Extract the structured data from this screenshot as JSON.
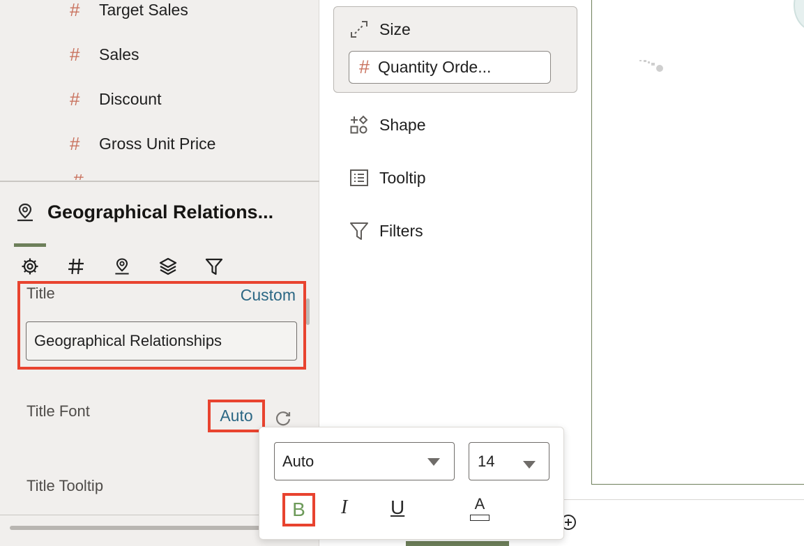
{
  "data_elements": {
    "fields": [
      {
        "icon": "#",
        "label": "Target Sales"
      },
      {
        "icon": "#",
        "label": "Sales"
      },
      {
        "icon": "#",
        "label": "Discount"
      },
      {
        "icon": "#",
        "label": "Gross Unit Price"
      }
    ]
  },
  "visualization": {
    "title": "Geographical Relations..."
  },
  "properties": {
    "tabs": [
      "gear-icon",
      "hash-icon",
      "map-pin-icon",
      "layers-icon",
      "filter-icon"
    ],
    "title_label": "Title",
    "title_mode": "Custom",
    "title_value": "Geographical Relationships",
    "title_font_label": "Title Font",
    "title_font_value": "Auto",
    "title_tooltip_label": "Title Tooltip"
  },
  "grammar": {
    "size_label": "Size",
    "size_field_icon": "#",
    "size_field": "Quantity Orde...",
    "shape_label": "Shape",
    "tooltip_label": "Tooltip",
    "filters_label": "Filters"
  },
  "font_popup": {
    "font_family": "Auto",
    "font_size": "14",
    "bold": "B",
    "italic": "I",
    "underline": "U",
    "color": "A"
  },
  "colors": {
    "highlight": "#e8432f",
    "accent_green": "#6d7f5a",
    "link_blue": "#2b6784",
    "measure_hash": "#c9735f"
  }
}
